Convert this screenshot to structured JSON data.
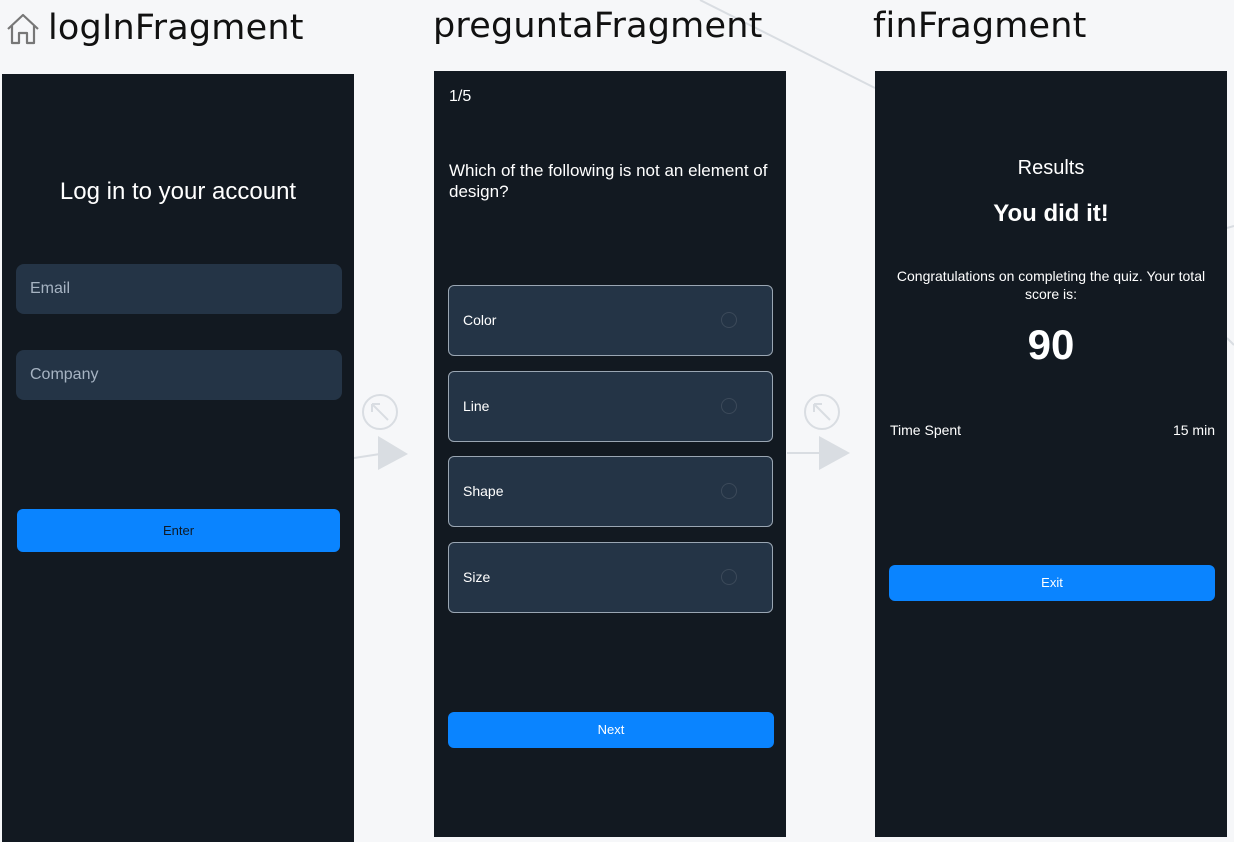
{
  "fragments": {
    "login": {
      "title": "logInFragment",
      "heading": "Log in to your account",
      "email_placeholder": "Email",
      "company_placeholder": "Company",
      "enter_label": "Enter"
    },
    "quiz": {
      "title": "preguntaFragment",
      "counter": "1/5",
      "question": "Which of the following is not an element of design?",
      "options": [
        {
          "label": "Color"
        },
        {
          "label": "Line"
        },
        {
          "label": "Shape"
        },
        {
          "label": "Size"
        }
      ],
      "next_label": "Next"
    },
    "fin": {
      "title": "finFragment",
      "results_label": "Results",
      "headline": "You did it!",
      "message": "Congratulations on completing the quiz. Your total score is:",
      "score": "90",
      "time_label": "Time Spent",
      "time_value": "15 min",
      "exit_label": "Exit"
    }
  },
  "icons": {
    "start": "home-icon",
    "transition": "arrow-up-left-circle-icon"
  },
  "colors": {
    "canvas_bg": "#f6f7f9",
    "screen_bg": "#121921",
    "field_bg": "#243446",
    "accent": "#0a84ff"
  }
}
